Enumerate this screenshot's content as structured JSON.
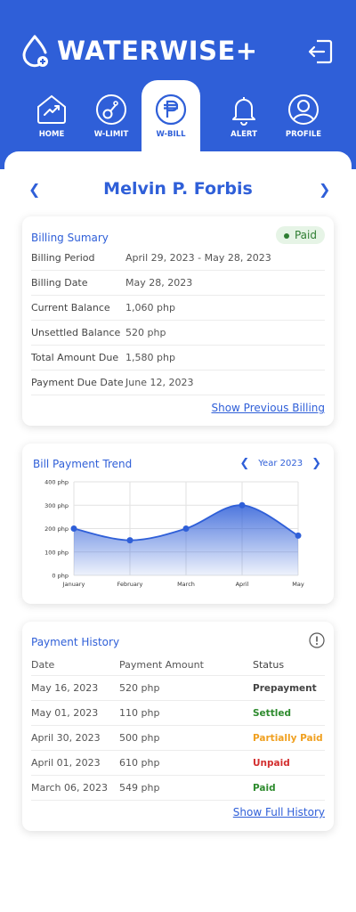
{
  "app": {
    "title": "WATERWISE+"
  },
  "nav": [
    {
      "label": "HOME",
      "icon": "home-chart-icon"
    },
    {
      "label": "W-LIMIT",
      "icon": "gauge-icon"
    },
    {
      "label": "W-BILL",
      "icon": "peso-icon"
    },
    {
      "label": "ALERT",
      "icon": "bell-icon"
    },
    {
      "label": "PROFILE",
      "icon": "user-icon"
    }
  ],
  "customer": {
    "name": "Melvin P. Forbis"
  },
  "billing": {
    "title": "Billing Sumary",
    "status": "Paid",
    "rows": [
      {
        "label": "Billing Period",
        "value": "April 29, 2023 - May 28, 2023"
      },
      {
        "label": "Billing Date",
        "value": "May 28, 2023"
      },
      {
        "label": "Current Balance",
        "value": "1,060 php"
      },
      {
        "label": "Unsettled Balance",
        "value": "520 php"
      },
      {
        "label": "Total Amount Due",
        "value": "1,580 php"
      },
      {
        "label": "Payment Due Date",
        "value": "June 12, 2023"
      }
    ],
    "link": "Show Previous Billing"
  },
  "trend": {
    "title": "Bill Payment Trend",
    "year": "Year 2023"
  },
  "chart_data": {
    "type": "area",
    "categories": [
      "January",
      "February",
      "March",
      "April",
      "May"
    ],
    "x": [
      "January",
      "February",
      "March",
      "April",
      "May"
    ],
    "values": [
      200,
      150,
      200,
      300,
      170
    ],
    "yticks": [
      "0 php",
      "100 php",
      "200 php",
      "300 php",
      "400 php"
    ],
    "ylim": [
      0,
      400
    ],
    "grid": true
  },
  "history": {
    "title": "Payment History",
    "columns": [
      "Date",
      "Payment Amount",
      "Status"
    ],
    "rows": [
      {
        "date": "May 16, 2023",
        "amount": "520 php",
        "status": "Prepayment",
        "color": "#444444"
      },
      {
        "date": "May 01, 2023",
        "amount": "110 php",
        "status": "Settled",
        "color": "#2e8b2e"
      },
      {
        "date": "April 30, 2023",
        "amount": "500 php",
        "status": "Partially Paid",
        "color": "#f0a020"
      },
      {
        "date": "April 01, 2023",
        "amount": "610 php",
        "status": "Unpaid",
        "color": "#d32f2f"
      },
      {
        "date": "March 06, 2023",
        "amount": "549 php",
        "status": "Paid",
        "color": "#2e8b2e"
      }
    ],
    "link": "Show Full History"
  },
  "colors": {
    "primary": "#2f5fd8",
    "paid_bg": "#e6f4e6",
    "paid": "#2e7d32"
  }
}
